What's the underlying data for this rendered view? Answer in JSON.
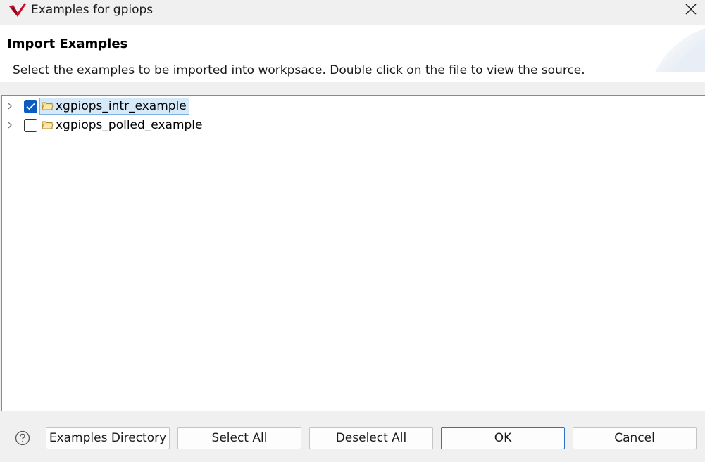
{
  "window": {
    "title": "Examples for gpiops",
    "app_icon": "vitis-logo-icon",
    "close_icon": "close-icon"
  },
  "header": {
    "title": "Import Examples",
    "description": "Select the examples to be imported into workpsace. Double click on the file to view the source."
  },
  "tree": {
    "items": [
      {
        "label": "xgpiops_intr_example",
        "checked": true,
        "selected": true,
        "expanded": false,
        "icon": "folder-icon"
      },
      {
        "label": "xgpiops_polled_example",
        "checked": false,
        "selected": false,
        "expanded": false,
        "icon": "folder-icon"
      }
    ]
  },
  "footer": {
    "help_icon": "help-icon",
    "examples_directory_label": "Examples Directory",
    "select_all_label": "Select All",
    "deselect_all_label": "Deselect All",
    "ok_label": "OK",
    "cancel_label": "Cancel"
  },
  "colors": {
    "accent": "#0a5cc0",
    "selection_bg": "#d6e9f8",
    "default_button_border": "#2a76c6",
    "logo_red": "#c8102e"
  }
}
